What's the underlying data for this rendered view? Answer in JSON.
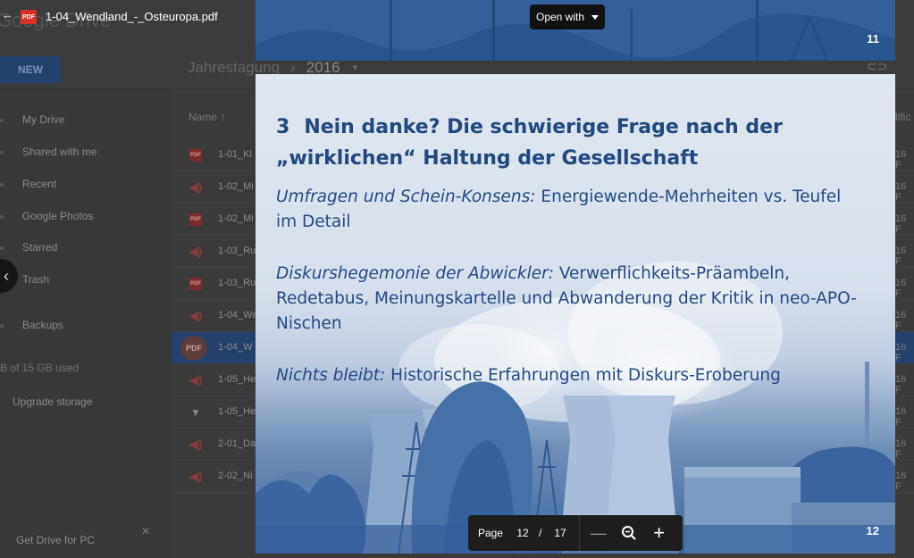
{
  "drive": {
    "brand": "Google Drive",
    "new_label": "NEW",
    "breadcrumb": {
      "parent": "Jahrestagung",
      "current": "2016"
    },
    "sidebar": [
      {
        "label": "My Drive"
      },
      {
        "label": "Shared with me"
      },
      {
        "label": "Recent"
      },
      {
        "label": "Google Photos"
      },
      {
        "label": "Starred"
      },
      {
        "label": "Trash"
      },
      {
        "label": "Backups"
      }
    ],
    "storage_text": "B of 15 GB used",
    "upgrade_label": "Upgrade storage",
    "get_drive_label": "Get Drive for PC",
    "list_header": {
      "name": "Name",
      "modified": "dific"
    },
    "files": [
      {
        "name": "1-01_Kl",
        "kind": "pdf",
        "date": "16 F"
      },
      {
        "name": "1-02_Mi",
        "kind": "audio",
        "date": "16 F"
      },
      {
        "name": "1-02_Mi",
        "kind": "pdf",
        "date": "16 F"
      },
      {
        "name": "1-03_Ru",
        "kind": "audio",
        "date": "16 F"
      },
      {
        "name": "1-03_Ru",
        "kind": "pdf",
        "date": "16 F"
      },
      {
        "name": "1-04_We",
        "kind": "audio",
        "date": "16 F"
      },
      {
        "name": "1-04_W",
        "kind": "pdf",
        "date": "16 F",
        "selected": true
      },
      {
        "name": "1-05_He",
        "kind": "audio",
        "date": "16 F"
      },
      {
        "name": "1-05_He",
        "kind": "archive",
        "date": "16 F"
      },
      {
        "name": "2-01_Da",
        "kind": "audio",
        "date": "16 F"
      },
      {
        "name": "2-02_Ni",
        "kind": "audio",
        "date": "16 F"
      }
    ]
  },
  "viewer": {
    "file_name": "1-04_Wendland_-_Osteuropa.pdf",
    "pdf_badge": "PDF",
    "open_with_label": "Open with"
  },
  "slides": {
    "prev": {
      "number": "11"
    },
    "current": {
      "number": "12",
      "heading_num": "3",
      "heading_line1": "Nein danke? Die schwierige Frage nach der",
      "heading_line2": "„wirklichen“ Haltung der Gesellschaft",
      "paragraphs": [
        {
          "lead": "Umfragen und Schein-Konsens:",
          "text": " Energiewende-Mehrheiten vs. Teufel im Detail"
        },
        {
          "lead": "Diskurshegemonie der Abwickler:",
          "text": " Verwerflichkeits-Präambeln, Redetabus, Meinungskartelle und Abwanderung der Kritik in neo-APO-Nischen"
        },
        {
          "lead": "Nichts bleibt:",
          "text": " Historische Erfahrungen mit Diskurs-Eroberung"
        }
      ]
    }
  },
  "pager": {
    "label": "Page",
    "current": "12",
    "separator": "/",
    "total": "17"
  },
  "colors": {
    "slide_blue": "#244a85",
    "pdf_red": "#d93025",
    "selected_row": "#24406d"
  }
}
